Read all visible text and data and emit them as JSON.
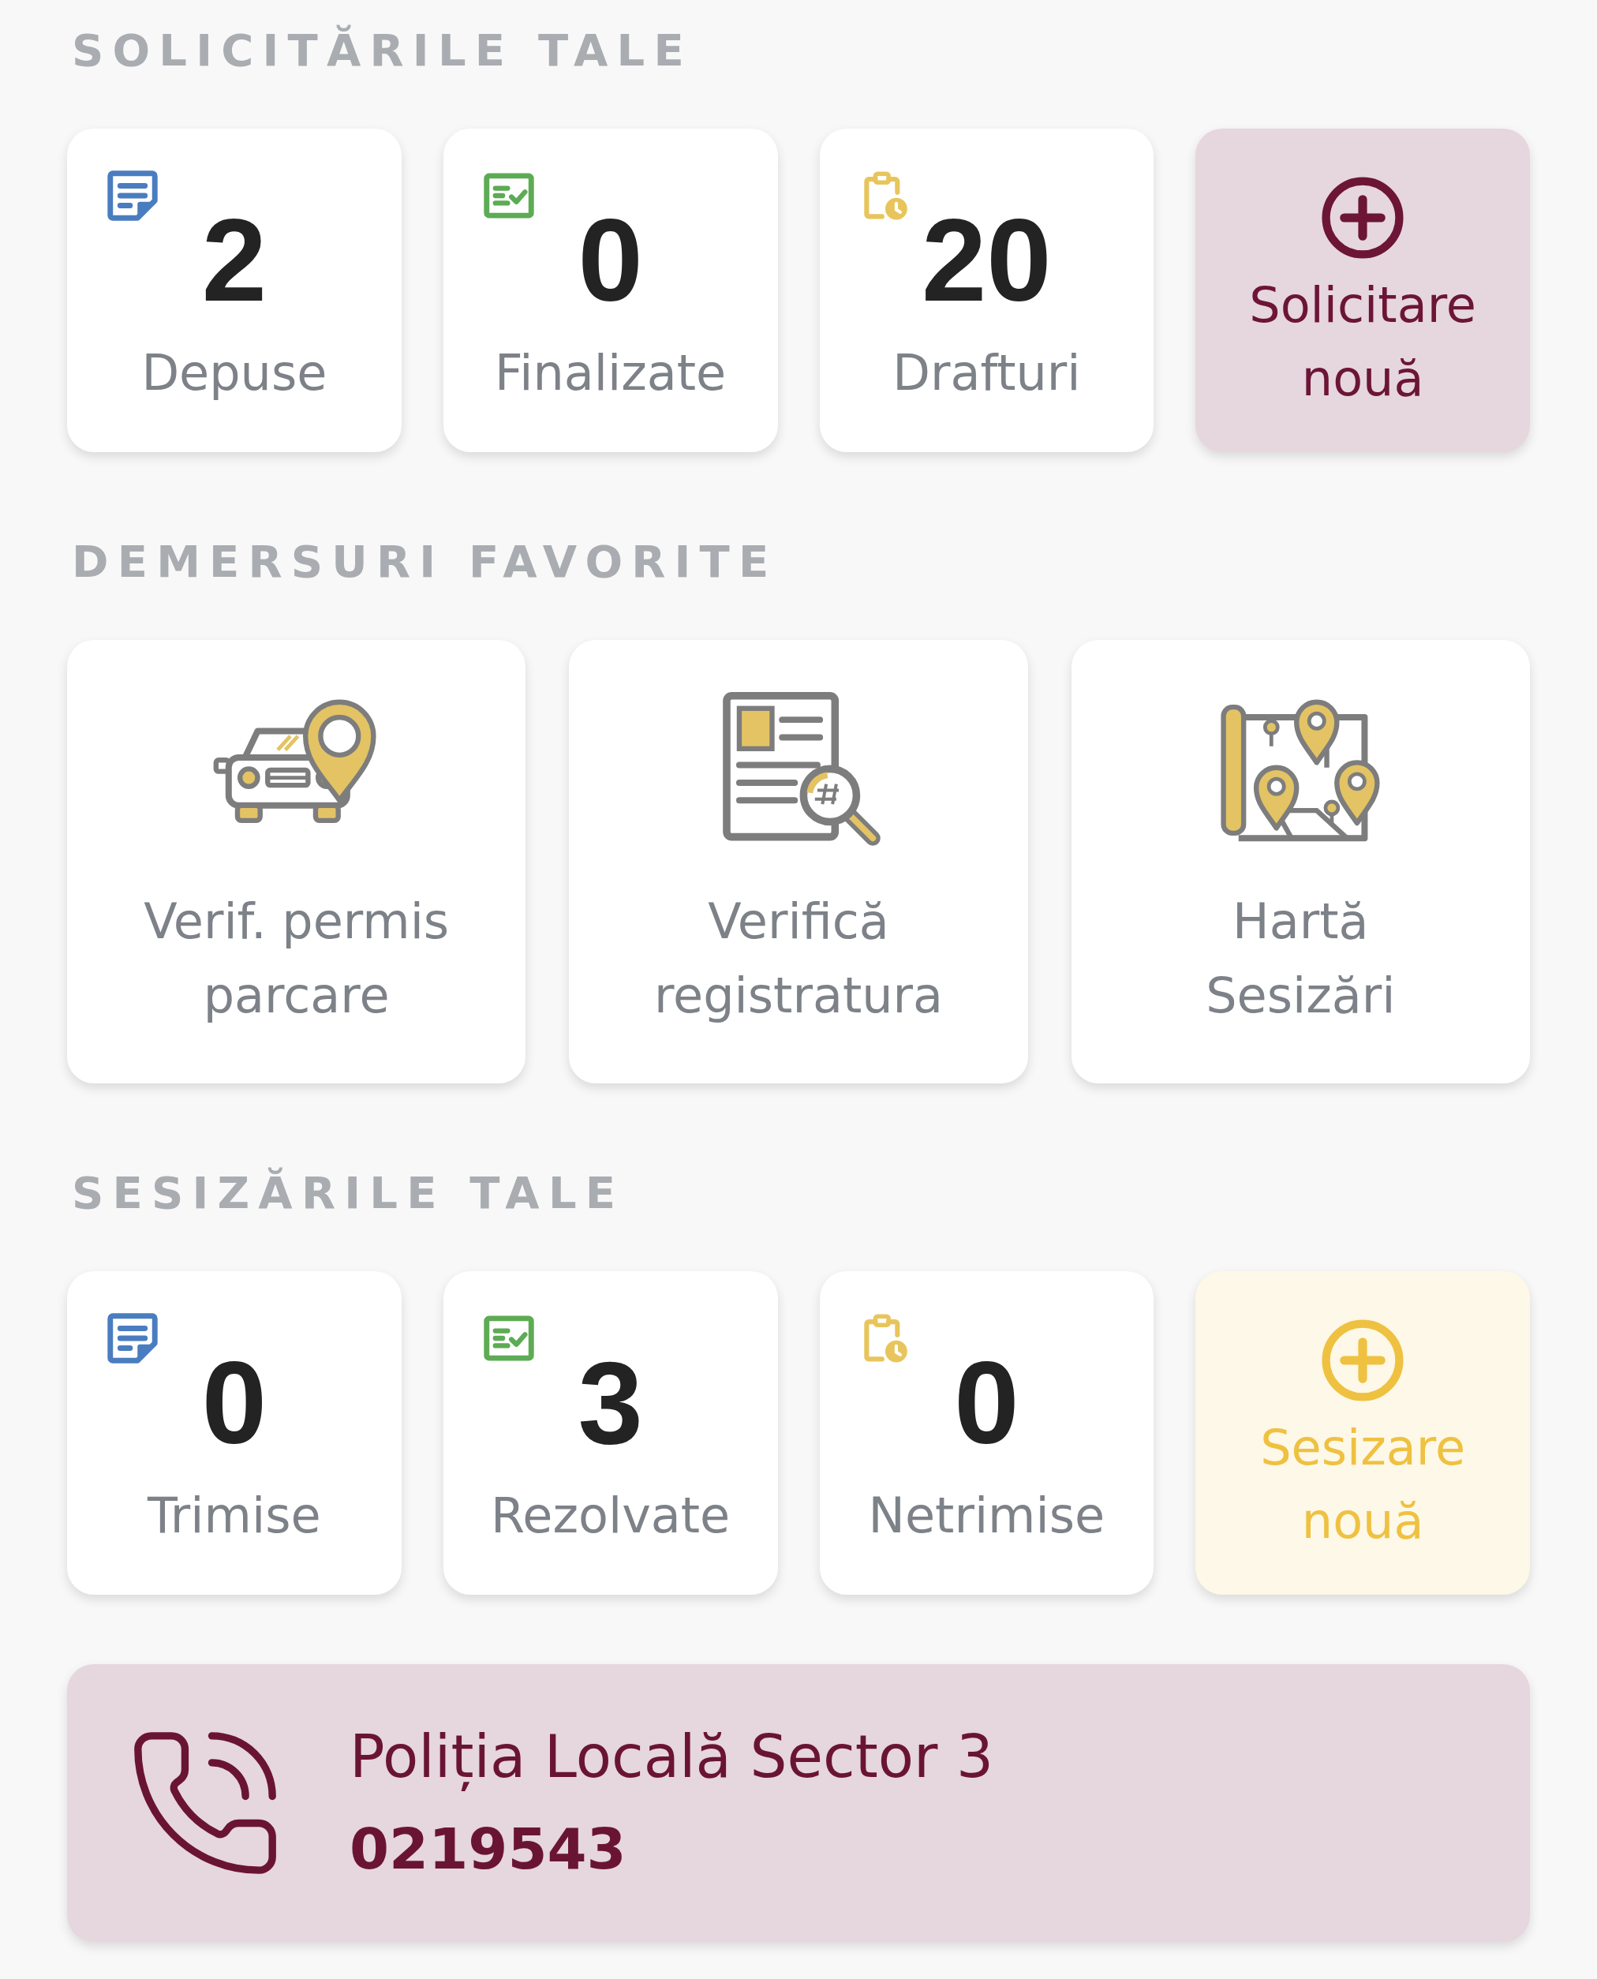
{
  "sections": [
    {
      "kind": "requests",
      "title": "SOLICITĂRILE TALE",
      "stats": [
        {
          "kind": "submitted",
          "value": "2",
          "label": "Depuse"
        },
        {
          "kind": "done",
          "value": "0",
          "label": "Finalizate"
        },
        {
          "kind": "draft",
          "value": "20",
          "label": "Drafturi"
        }
      ],
      "add_button": {
        "label": "Solicitare nouă"
      }
    },
    {
      "kind": "favorites",
      "title": "DEMERSURI FAVORITE",
      "items": [
        {
          "kind": "parking",
          "label": "Verif. permis\nparcare"
        },
        {
          "kind": "registry",
          "label": "Verifică\nregistratura"
        },
        {
          "kind": "map",
          "label": "Hartă\nSesizări"
        }
      ]
    },
    {
      "kind": "reports",
      "title": "SESIZĂRILE TALE",
      "stats": [
        {
          "kind": "submitted",
          "value": "0",
          "label": "Trimise"
        },
        {
          "kind": "done",
          "value": "3",
          "label": "Rezolvate"
        },
        {
          "kind": "draft",
          "value": "0",
          "label": "Netrimise"
        }
      ],
      "add_button": {
        "label": "Sesizare nouă"
      }
    }
  ],
  "contact": {
    "name": "Poliția Locală Sector 3",
    "phone": "0219543"
  }
}
